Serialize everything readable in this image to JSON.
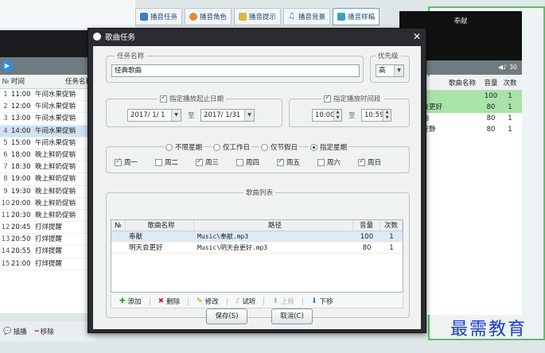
{
  "background": {
    "tabs": [
      {
        "label": "播音任务",
        "color": "#3a7fc8"
      },
      {
        "label": "播音角色",
        "color": "#e08a3a"
      },
      {
        "label": "播音提示",
        "color": "#e0b83a"
      },
      {
        "label": "播音背景",
        "color": "#3a7fc8"
      },
      {
        "label": "播音样稿",
        "color": "#3a9fc8"
      }
    ],
    "task_table": {
      "headers": {
        "no": "№",
        "time": "时间",
        "name": "任务名称"
      },
      "rows": [
        {
          "no": "1",
          "time": "11:00",
          "name": "午间水果促销"
        },
        {
          "no": "2",
          "time": "12:00",
          "name": "午间水果促销"
        },
        {
          "no": "3",
          "time": "13:00",
          "name": "午间水果促销"
        },
        {
          "no": "4",
          "time": "14:00",
          "name": "午间水果促销"
        },
        {
          "no": "5",
          "time": "15:00",
          "name": "午间水果促销"
        },
        {
          "no": "6",
          "time": "18:00",
          "name": "晚上鲜奶促销"
        },
        {
          "no": "7",
          "time": "18:30",
          "name": "晚上鲜奶促销"
        },
        {
          "no": "8",
          "time": "19:00",
          "name": "晚上鲜奶促销"
        },
        {
          "no": "9",
          "time": "19:30",
          "name": "晚上鲜奶促销"
        },
        {
          "no": "10",
          "time": "20:00",
          "name": "晚上鲜奶促销"
        },
        {
          "no": "11",
          "time": "20:30",
          "name": "晚上鲜奶促销"
        },
        {
          "no": "12",
          "time": "20:45",
          "name": "打烊提醒"
        },
        {
          "no": "13",
          "time": "20:50",
          "name": "打烊提醒"
        },
        {
          "no": "14",
          "time": "20:55",
          "name": "打烊提醒"
        },
        {
          "no": "15",
          "time": "21:00",
          "name": "打烊提醒"
        }
      ],
      "selected_index": 3
    },
    "bottom_buttons": {
      "insert": "插播",
      "remove": "移除"
    },
    "right_panel": {
      "now_playing": "奉献",
      "volume_readout": "30",
      "headers": {
        "name": "歌曲名称",
        "vol": "音量",
        "count": "次数"
      },
      "rows": [
        {
          "name": "献",
          "vol": "100",
          "count": "1",
          "playing": true
        },
        {
          "name": "天会更好",
          "vol": "80",
          "count": "1",
          "playing": true
        },
        {
          "name": "加油",
          "vol": "80",
          "count": "1",
          "playing": false
        },
        {
          "name": "谢安静",
          "vol": "80",
          "count": "1",
          "playing": false
        }
      ]
    }
  },
  "dialog": {
    "title": "歌曲任务",
    "close_glyph": "✕",
    "task_name": {
      "legend": "任务名称",
      "value": "经典歌曲"
    },
    "priority": {
      "legend": "优先级",
      "value": "高"
    },
    "date_range": {
      "legend": "指定播放起止日期",
      "checked": true,
      "start": "2017/ 1/ 1",
      "end": "2017/ 1/31",
      "to": "至"
    },
    "time_range": {
      "legend": "指定播放时间段",
      "checked": true,
      "start": "10:00",
      "end": "10:59",
      "to": "至"
    },
    "weekday_mode": {
      "options": [
        {
          "label": "不限星期",
          "selected": false
        },
        {
          "label": "仅工作日",
          "selected": false
        },
        {
          "label": "仅节假日",
          "selected": false
        },
        {
          "label": "指定星期",
          "selected": true
        }
      ],
      "days": [
        {
          "label": "周一",
          "checked": true
        },
        {
          "label": "周二",
          "checked": false
        },
        {
          "label": "周三",
          "checked": true
        },
        {
          "label": "周四",
          "checked": false
        },
        {
          "label": "周五",
          "checked": true
        },
        {
          "label": "周六",
          "checked": false
        },
        {
          "label": "周日",
          "checked": true
        }
      ]
    },
    "song_list": {
      "legend": "歌曲列表",
      "headers": {
        "no": "№",
        "name": "歌曲名称",
        "path": "路径",
        "vol": "音量",
        "count": "次数"
      },
      "rows": [
        {
          "no": "",
          "name": "奉献",
          "path": "Music\\奉献.mp3",
          "vol": "100",
          "count": "1"
        },
        {
          "no": "",
          "name": "明天会更好",
          "path": "Music\\明天会更好.mp3",
          "vol": "80",
          "count": "1"
        }
      ]
    },
    "toolbar": {
      "add": "添加",
      "delete": "删除",
      "edit": "修改",
      "preview": "试听",
      "up": "上移",
      "down": "下移"
    },
    "buttons": {
      "save": "保存(S)",
      "cancel": "取消(C)"
    }
  },
  "watermark": "最需教育"
}
